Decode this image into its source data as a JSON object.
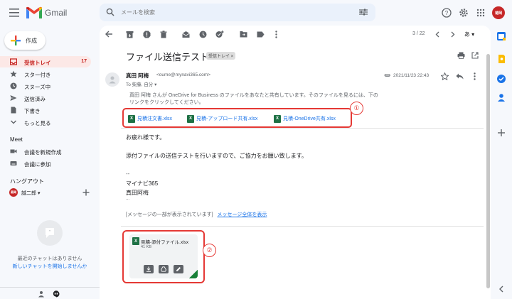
{
  "header": {
    "app_name": "Gmail",
    "search_placeholder": "メールを検索",
    "avatar_initials": "菊岡"
  },
  "sidebar": {
    "compose_label": "作成",
    "items": [
      {
        "label": "受信トレイ",
        "count": "17",
        "icon": "inbox-icon",
        "active": true
      },
      {
        "label": "スター付き",
        "count": "",
        "icon": "star-icon"
      },
      {
        "label": "スヌーズ中",
        "count": "",
        "icon": "clock-icon"
      },
      {
        "label": "送信済み",
        "count": "",
        "icon": "send-icon"
      },
      {
        "label": "下書き",
        "count": "",
        "icon": "draft-icon"
      },
      {
        "label": "もっと見る",
        "count": "",
        "icon": "chevron-down-icon"
      }
    ],
    "meet": {
      "title": "Meet",
      "items": [
        {
          "label": "会議を新規作成",
          "icon": "video-icon"
        },
        {
          "label": "会議に参加",
          "icon": "keyboard-icon"
        }
      ]
    },
    "hangouts": {
      "title": "ハングアウト",
      "user": "誠二郎 ▾",
      "avatar_initials": "菊岡",
      "no_chat": "最近のチャットはありません",
      "new_chat": "新しいチャットを開始しませんか"
    }
  },
  "toolbar": {
    "pager": "3 / 22",
    "lang": "あ ▾"
  },
  "message": {
    "subject": "ファイル送信テスト",
    "label_chip": "受信トレイ ×",
    "sender_name": "真田 阿梅",
    "sender_email": "<oume@mynavi365.com>",
    "recipients": "To 柴藤, 自分 ▾",
    "date": "2021/11/23 22:43",
    "onedrive_notice": "真田 阿梅 さんが OneDrive for Business のファイルをあなたと共有しています。そのファイルを見るには、下のリンクをクリックしてください。",
    "shared_files": [
      "見積注文書.xlsx",
      "見積-アップロード共有.xlsx",
      "見積-OneDrive共有.xlsx"
    ],
    "badge1": "①",
    "body_lines": [
      "お疲れ様です。",
      "添付ファイルの送信テストを行いますので、ご協力をお願い致します。",
      "--",
      "マイナビ365",
      "真田阿梅",
      "..."
    ],
    "truncated_notice": "[メッセージの一部が表示されています]",
    "truncated_link": "メッセージ全体を表示",
    "attachment": {
      "name": "見積-添付ファイル.xlsx",
      "size": "41 KB"
    },
    "badge2": "②"
  },
  "colors": {
    "accent_red": "#e53935",
    "link_blue": "#1a73e8",
    "excel_green": "#1e7145"
  }
}
